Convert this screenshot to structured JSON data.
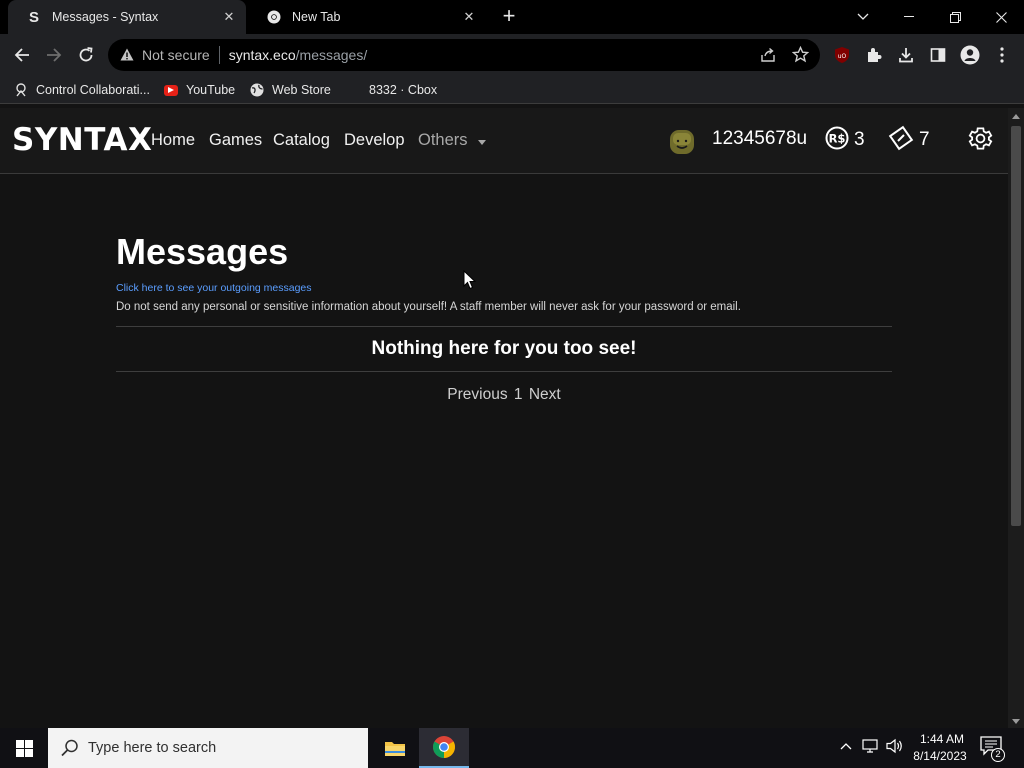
{
  "browser": {
    "tabs": [
      {
        "title": "Messages - Syntax",
        "favicon": "S",
        "active": true
      },
      {
        "title": "New Tab",
        "favicon": "chrome-icon",
        "active": false
      }
    ],
    "omnibox": {
      "security_label": "Not secure",
      "url_host": "syntax.eco",
      "url_path": "/messages/"
    },
    "bookmarks": [
      {
        "label": "Control Collaborati...",
        "icon": "collab-icon"
      },
      {
        "label": "YouTube",
        "icon": "youtube-icon"
      },
      {
        "label": "Web Store",
        "icon": "webstore-icon"
      },
      {
        "label": "8332 · Cbox",
        "icon": ""
      }
    ]
  },
  "site": {
    "logo": "SYNTAX",
    "nav": {
      "home": "Home",
      "games": "Games",
      "catalog": "Catalog",
      "develop": "Develop",
      "others": "Others"
    },
    "user": {
      "username": "12345678u",
      "robux": "3",
      "tix": "7"
    }
  },
  "messages": {
    "title": "Messages",
    "outgoing_link": "Click here to see your outgoing messages",
    "warning": "Do not send any personal or sensitive information about yourself! A staff member will never ask for your password or email.",
    "empty_text": "Nothing here for you too see!",
    "pager": {
      "previous": "Previous",
      "page": "1",
      "next": "Next"
    }
  },
  "taskbar": {
    "search_placeholder": "Type here to search",
    "time": "1:44 AM",
    "date": "8/14/2023",
    "notifications": "2"
  },
  "colors": {
    "page_bg": "#131313",
    "navbar_bg": "#181818",
    "link_blue": "#5b9eff"
  }
}
